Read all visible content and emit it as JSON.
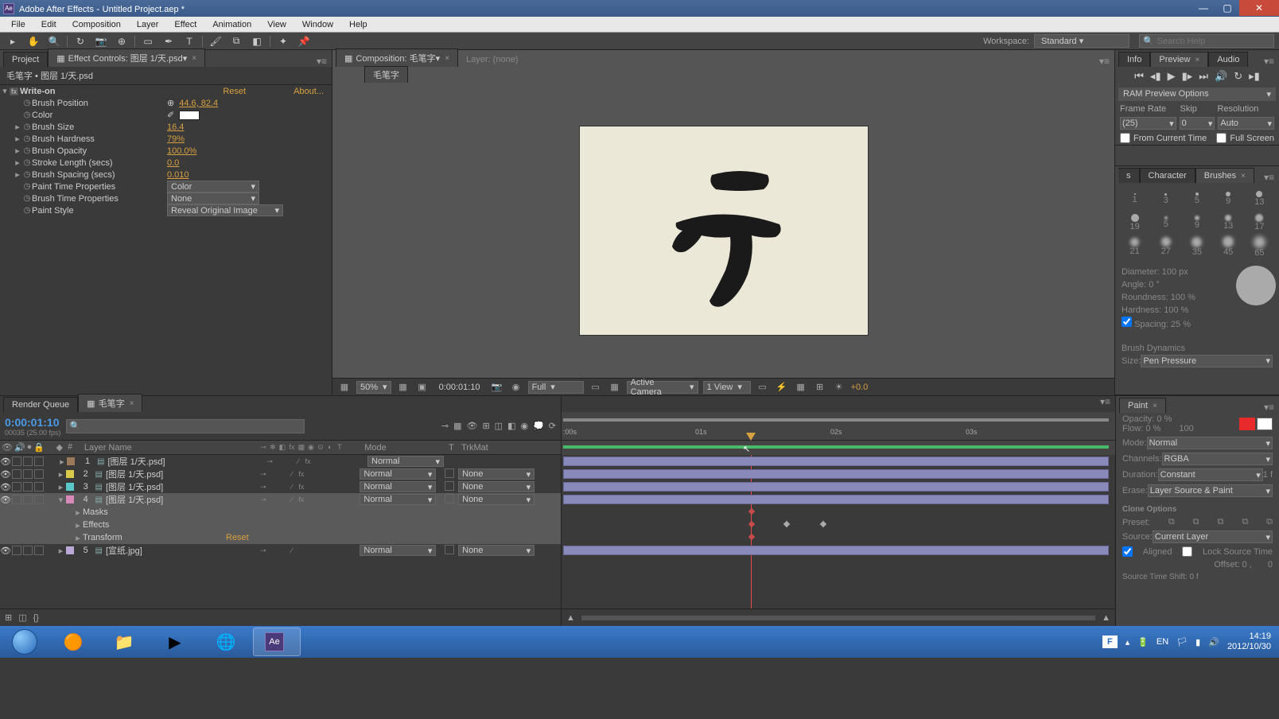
{
  "titlebar": {
    "app": "Adobe After Effects",
    "project": "Untitled Project.aep *"
  },
  "menubar": [
    "File",
    "Edit",
    "Composition",
    "Layer",
    "Effect",
    "Animation",
    "View",
    "Window",
    "Help"
  ],
  "toolbar": {
    "workspace_label": "Workspace:",
    "workspace_value": "Standard",
    "help_placeholder": "Search Help"
  },
  "left_panel": {
    "tab_project": "Project",
    "tab_effect": "Effect Controls: 图层 1/天.psd",
    "breadcrumb": "毛笔字 • 图层 1/天.psd",
    "effect_name": "Write-on",
    "reset": "Reset",
    "about": "About...",
    "props": {
      "brush_position": {
        "label": "Brush Position",
        "val": "44.6, 82.4"
      },
      "color": {
        "label": "Color"
      },
      "brush_size": {
        "label": "Brush Size",
        "val": "16.4"
      },
      "brush_hardness": {
        "label": "Brush Hardness",
        "val": "79%"
      },
      "brush_opacity": {
        "label": "Brush Opacity",
        "val": "100.0%"
      },
      "stroke_length": {
        "label": "Stroke Length (secs)",
        "val": "0.0"
      },
      "brush_spacing": {
        "label": "Brush Spacing (secs)",
        "val": "0.010"
      },
      "paint_time": {
        "label": "Paint Time Properties",
        "val": "Color"
      },
      "brush_time": {
        "label": "Brush Time Properties",
        "val": "None"
      },
      "paint_style": {
        "label": "Paint Style",
        "val": "Reveal Original Image"
      }
    }
  },
  "center_panel": {
    "tab_comp": "Composition: 毛笔字",
    "tab_layer": "Layer: (none)",
    "sub_tab": "毛笔字",
    "footer": {
      "zoom": "50%",
      "time": "0:00:01:10",
      "resolution": "Full",
      "camera": "Active Camera",
      "view": "1 View",
      "exposure": "+0.0"
    }
  },
  "right_panel": {
    "tab_info": "Info",
    "tab_preview": "Preview",
    "tab_audio": "Audio",
    "ram_options": "RAM Preview Options",
    "labels": {
      "frame_rate": "Frame Rate",
      "skip": "Skip",
      "resolution": "Resolution"
    },
    "values": {
      "frame_rate": "(25)",
      "skip": "0",
      "resolution": "Auto"
    },
    "from_current": "From Current Time",
    "full_screen": "Full Screen",
    "tab_character": "Character",
    "tab_brushes": "Brushes",
    "brush_labels": [
      "1",
      "3",
      "5",
      "9",
      "13",
      "19",
      "5",
      "9",
      "13",
      "17",
      "21",
      "27",
      "35",
      "45",
      "65"
    ],
    "brush_props": {
      "diameter": "Diameter: 100 px",
      "angle": "Angle: 0 °",
      "roundness": "Roundness: 100 %",
      "hardness": "Hardness: 100 %",
      "spacing": "Spacing: 25 %"
    },
    "brush_dynamics": "Brush Dynamics",
    "size_label": "Size:",
    "size_val": "Pen Pressure"
  },
  "timeline": {
    "tab_render": "Render Queue",
    "tab_comp": "毛笔字",
    "timecode": "0:00:01:10",
    "timecode_sub": "00035 (25.00 fps)",
    "columns": {
      "num": "#",
      "layer_name": "Layer Name",
      "mode": "Mode",
      "t": "T",
      "trkmat": "TrkMat"
    },
    "time_ticks": [
      ":00s",
      "01s",
      "02s",
      "03s"
    ],
    "layers": [
      {
        "num": "1",
        "name": "[图层 1/天.psd]",
        "mode": "Normal",
        "trk": "",
        "color": "#9a7a5a"
      },
      {
        "num": "2",
        "name": "[图层 1/天.psd]",
        "mode": "Normal",
        "trk": "None",
        "color": "#d8c84a"
      },
      {
        "num": "3",
        "name": "[图层 1/天.psd]",
        "mode": "Normal",
        "trk": "None",
        "color": "#5ac8c8"
      },
      {
        "num": "4",
        "name": "[图层 1/天.psd]",
        "mode": "Normal",
        "trk": "None",
        "color": "#d88aba",
        "expanded": true
      },
      {
        "num": "5",
        "name": "[宣纸.jpg]",
        "mode": "Normal",
        "trk": "None",
        "color": "#baa8d8"
      }
    ],
    "sub_items": {
      "masks": "Masks",
      "effects": "Effects",
      "transform": "Transform",
      "reset": "Reset"
    }
  },
  "paint_panel": {
    "tab": "Paint",
    "opacity": "Opacity: 0 %",
    "flow": "Flow: 0 %",
    "flow_val": "100",
    "mode": "Mode:",
    "mode_val": "Normal",
    "channels": "Channels:",
    "channels_val": "RGBA",
    "duration": "Duration:",
    "duration_val": "Constant",
    "duration_n": "1 f",
    "erase": "Erase:",
    "erase_val": "Layer Source & Paint",
    "clone": "Clone Options",
    "preset": "Preset:",
    "source": "Source:",
    "source_val": "Current Layer",
    "aligned": "Aligned",
    "lock": "Lock Source Time",
    "offset": "Offset: 0 ,",
    "offset_y": "0",
    "time_shift": "Source Time Shift: 0 f"
  },
  "taskbar": {
    "time": "14:19",
    "date": "2012/10/30",
    "lang": "EN"
  }
}
